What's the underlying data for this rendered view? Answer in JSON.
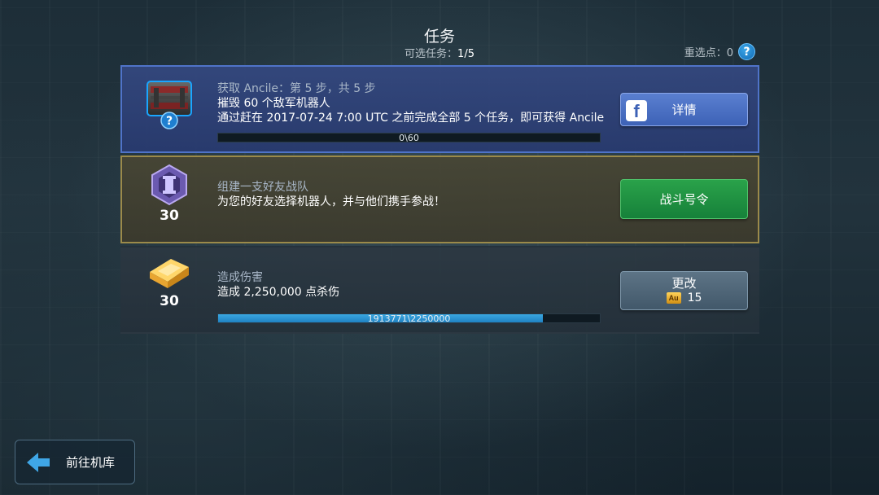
{
  "header": {
    "title": "任务",
    "available_label": "可选任务：",
    "available_value": "1/5",
    "reroll_label": "重选点：0",
    "help_icon": "question-mark-icon"
  },
  "tasks": [
    {
      "kicker": "获取 Ancile：第 5 步，共 5 步",
      "description": "摧毁 60 个敌军机器人",
      "note": "通过赶在 2017-07-24 7:00 UTC 之前完成全部 5 个任务，即可获得 Ancile",
      "progress_text": "0\\60",
      "progress": 0.0,
      "button_label": "详情",
      "icon": "robot-crate-icon"
    },
    {
      "kicker": "组建一支好友战队",
      "description": "为您的好友选择机器人，并与他们携手参战！",
      "reward_count": "30",
      "button_label": "战斗号令",
      "icon": "squad-emblem-icon"
    },
    {
      "kicker": "造成伤害",
      "description": "造成 2,250,000 点杀伤",
      "reward_count": "30",
      "progress_text": "1913771\\2250000",
      "progress": 0.8506,
      "button_label": "更改",
      "button_cost": "15",
      "cost_currency": "Au",
      "icon": "gold-bar-icon"
    }
  ],
  "footer": {
    "back_label": "前往机库"
  },
  "colors": {
    "progress_fill": "#2a96d4",
    "details_button": "#4a6fc4",
    "battle_button": "#1f9442",
    "change_button": "#4f6678"
  }
}
